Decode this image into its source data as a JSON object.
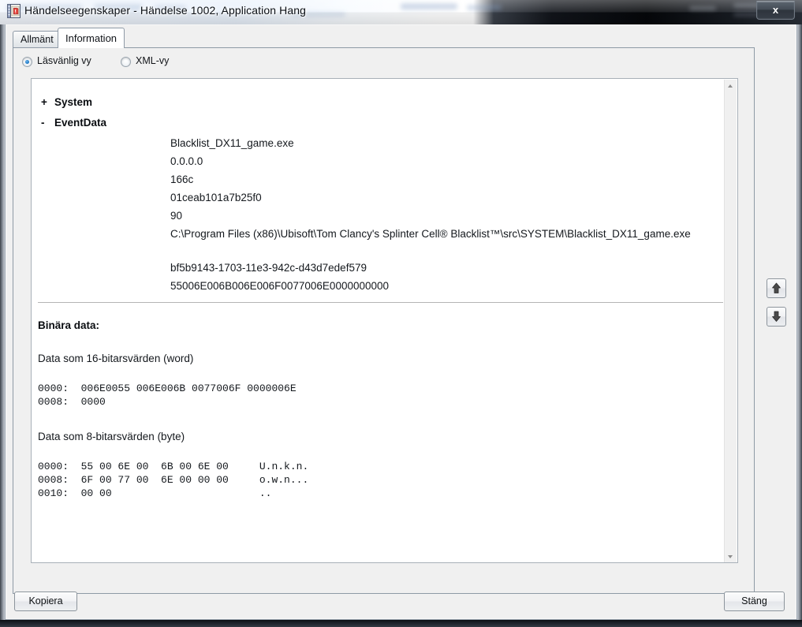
{
  "window": {
    "title": "Händelseegenskaper - Händelse 1002, Application Hang",
    "icon": "event-log-properties-icon",
    "close_label": "x"
  },
  "tabs": [
    {
      "label": "Allmänt",
      "active": false
    },
    {
      "label": "Information",
      "active": true
    }
  ],
  "view_options": [
    {
      "label": "Läsvänlig vy",
      "selected": true
    },
    {
      "label": "XML-vy",
      "selected": false
    }
  ],
  "tree": {
    "system": {
      "sign": "+",
      "label": "System",
      "expanded": false
    },
    "eventdata": {
      "sign": "-",
      "label": "EventData",
      "expanded": true
    }
  },
  "event_data_values": [
    "Blacklist_DX11_game.exe",
    "0.0.0.0",
    "166c",
    "01ceab101a7b25f0",
    "90",
    "C:\\Program Files (x86)\\Ubisoft\\Tom Clancy's Splinter Cell® Blacklist™\\src\\SYSTEM\\Blacklist_DX11_game.exe",
    "bf5b9143-1703-11e3-942c-d43d7edef579",
    "55006E006B006E006F0077006E0000000000"
  ],
  "binary": {
    "heading": "Binära data:",
    "word_label": "Data som 16-bitarsvärden (word)",
    "word_rows": [
      "0000:  006E0055 006E006B 0077006F 0000006E",
      "0008:  0000"
    ],
    "byte_label": "Data som 8-bitarsvärden (byte)",
    "byte_rows": [
      "0000:  55 00 6E 00  6B 00 6E 00     U.n.k.n.",
      "0008:  6F 00 77 00  6E 00 00 00     o.w.n...",
      "0010:  00 00                        .."
    ]
  },
  "nav_buttons": [
    {
      "icon": "arrow-up-icon",
      "name": "previous-event-button"
    },
    {
      "icon": "arrow-down-icon",
      "name": "next-event-button"
    }
  ],
  "footer": {
    "copy_label": "Kopiera",
    "close_label": "Stäng"
  },
  "scrollbar": {
    "up_icon": "scroll-up-arrow-icon",
    "down_icon": "scroll-down-arrow-icon"
  },
  "colors": {
    "accent": "#1572c0",
    "client_bg": "#f0f0f0",
    "panel_bg": "#ffffff",
    "frame": "#9ba5b0"
  }
}
